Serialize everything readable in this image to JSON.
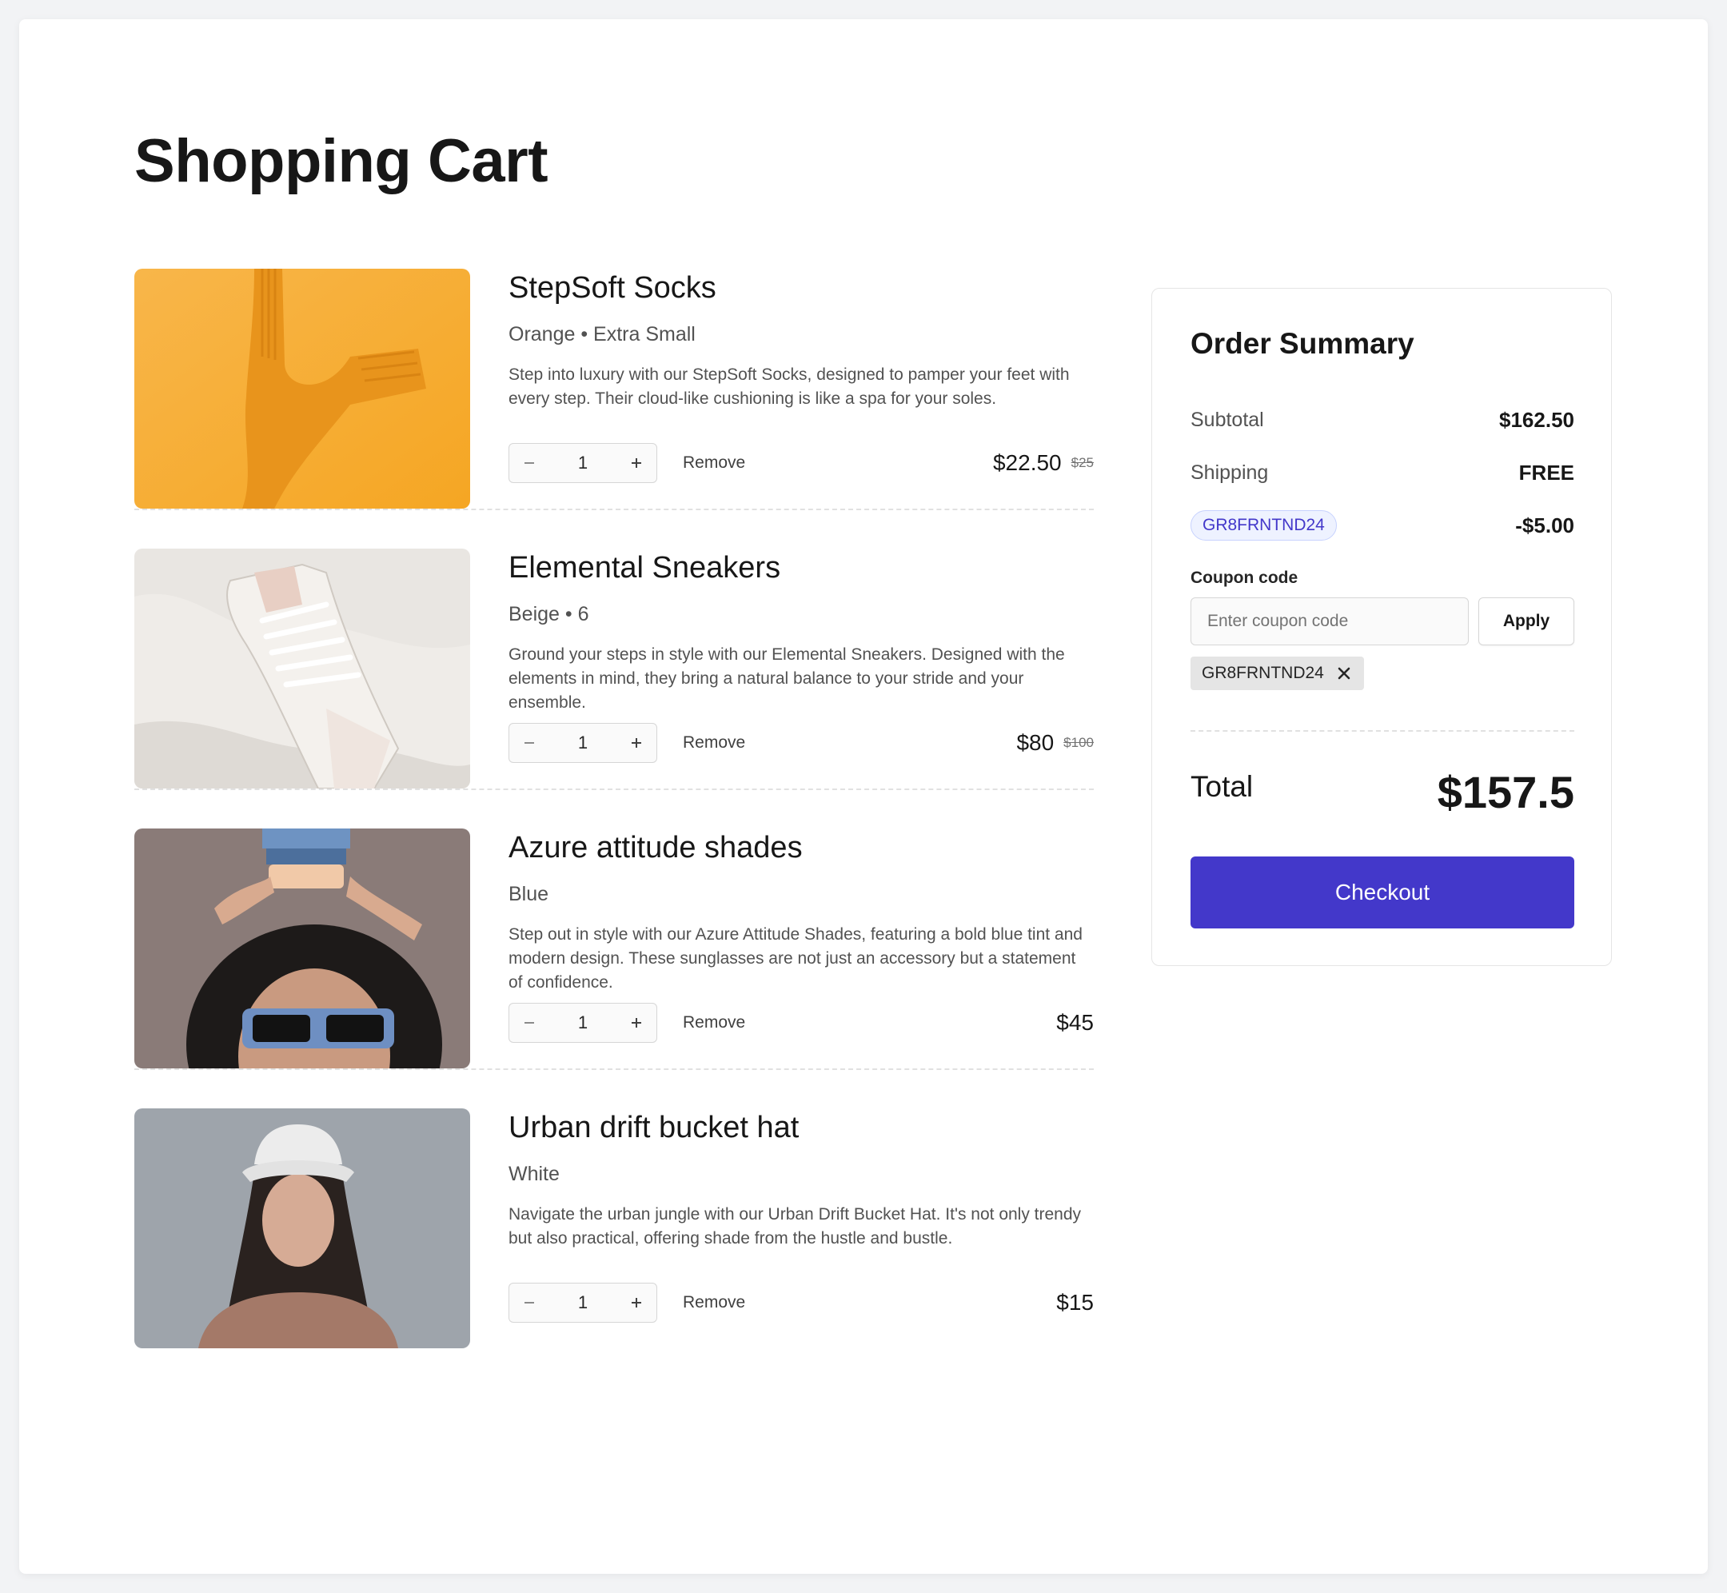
{
  "page": {
    "title": "Shopping Cart"
  },
  "cart": {
    "items": [
      {
        "name": "StepSoft Socks",
        "variant": "Orange • Extra Small",
        "description": "Step into luxury with our StepSoft Socks, designed to pamper your feet with every step. Their cloud-like cushioning is like a spa for your soles.",
        "quantity": "1",
        "remove_label": "Remove",
        "price": "$22.50",
        "original_price": "$25"
      },
      {
        "name": "Elemental Sneakers",
        "variant": "Beige • 6",
        "description": "Ground your steps in style with our Elemental Sneakers. Designed with the elements in mind, they bring a natural balance to your stride and your ensemble.",
        "quantity": "1",
        "remove_label": "Remove",
        "price": "$80",
        "original_price": "$100"
      },
      {
        "name": "Azure attitude shades",
        "variant": "Blue",
        "description": "Step out in style with our Azure Attitude Shades, featuring a bold blue tint and modern design. These sunglasses are not just an accessory but a statement of confidence.",
        "quantity": "1",
        "remove_label": "Remove",
        "price": "$45",
        "original_price": ""
      },
      {
        "name": "Urban drift bucket hat",
        "variant": "White",
        "description": "Navigate the urban jungle with our Urban Drift Bucket Hat. It's not only trendy but also practical, offering shade from the hustle and bustle.",
        "quantity": "1",
        "remove_label": "Remove",
        "price": "$15",
        "original_price": ""
      }
    ]
  },
  "summary": {
    "title": "Order Summary",
    "subtotal_label": "Subtotal",
    "subtotal_value": "$162.50",
    "shipping_label": "Shipping",
    "shipping_value": "FREE",
    "discount_code": "GR8FRNTND24",
    "discount_value": "-$5.00",
    "coupon_label": "Coupon code",
    "coupon_placeholder": "Enter coupon code",
    "apply_label": "Apply",
    "applied_code": "GR8FRNTND24",
    "total_label": "Total",
    "total_value": "$157.5",
    "checkout_label": "Checkout"
  },
  "colors": {
    "accent": "#4338ca",
    "badge_bg": "#eef2ff",
    "page_bg": "#f2f3f5"
  },
  "icons": {
    "decrement": "minus-icon",
    "increment": "plus-icon",
    "remove_coupon": "close-icon"
  }
}
